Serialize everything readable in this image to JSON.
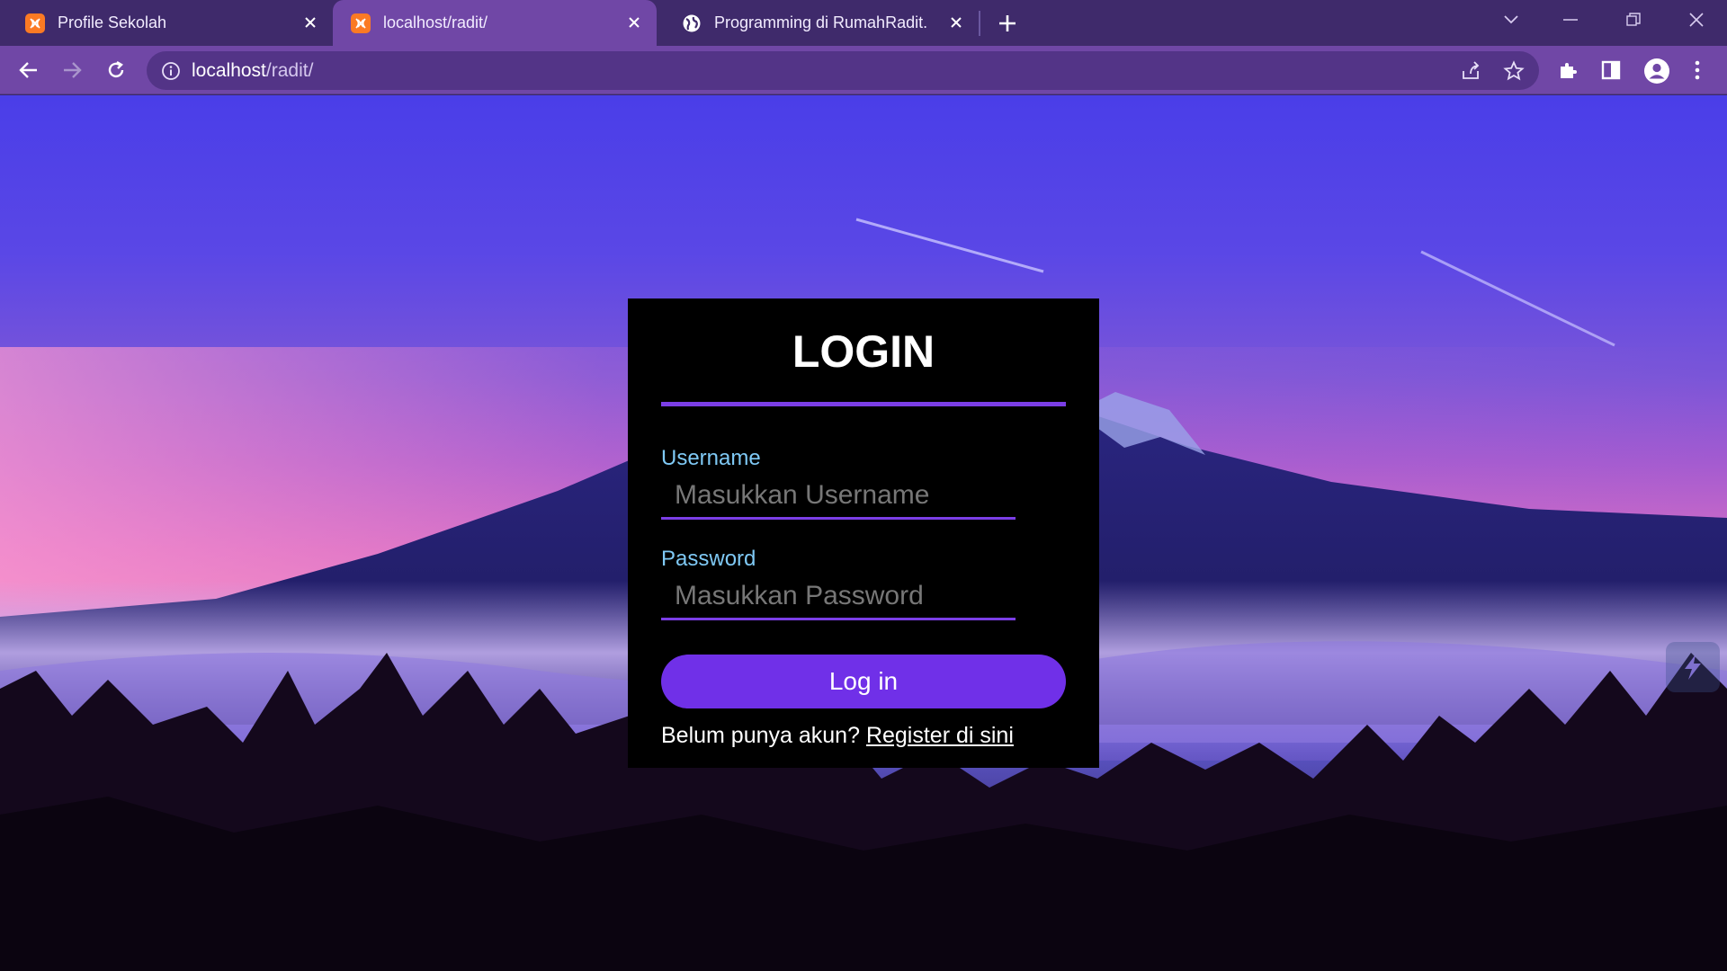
{
  "browser": {
    "tabs": [
      {
        "title": "Profile Sekolah",
        "favicon": "xampp-icon",
        "active": false
      },
      {
        "title": "localhost/radit/",
        "favicon": "xampp-icon",
        "active": true
      },
      {
        "title": "Programming di RumahRadit.",
        "favicon": "globe-icon",
        "active": false
      }
    ],
    "address": {
      "host": "localhost",
      "path": "/radit/"
    },
    "colors": {
      "frame": "#3f2a6b",
      "toolbar": "#7047a6",
      "omnibox": "#533487"
    }
  },
  "login": {
    "title": "LOGIN",
    "username_label": "Username",
    "username_placeholder": "Masukkan Username",
    "password_label": "Password",
    "password_placeholder": "Masukkan Password",
    "button_label": "Log in",
    "register_prompt": "Belum punya akun?",
    "register_link": "Register di sini",
    "colors": {
      "accent": "#7b3ee6",
      "button": "#7030e8",
      "label": "#7fc9f5",
      "card": "#000000"
    }
  }
}
